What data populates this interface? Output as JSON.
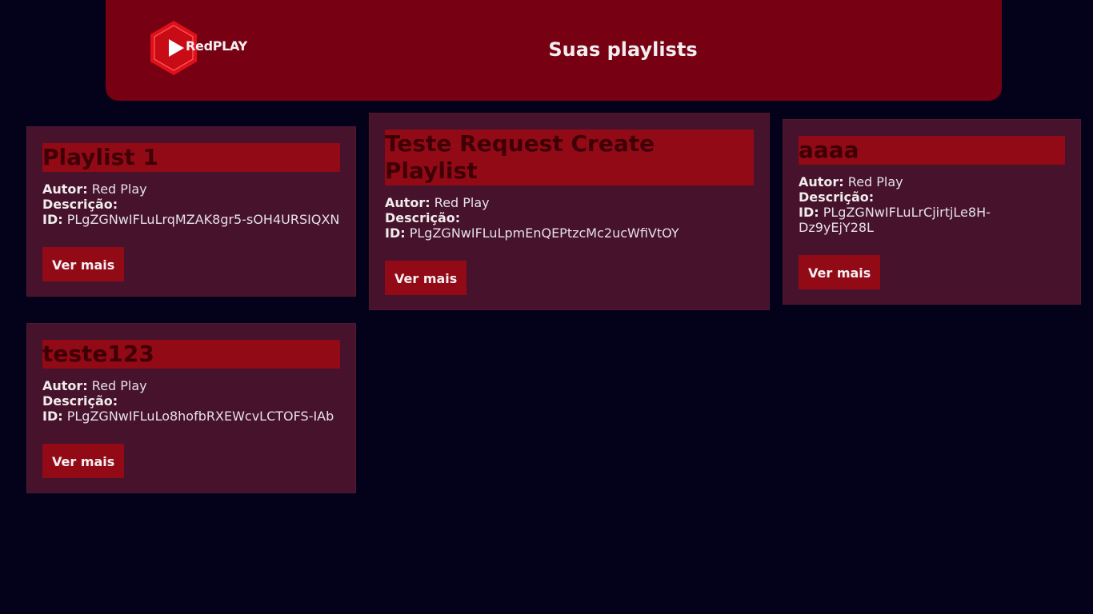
{
  "header": {
    "logo_text": "RedPLAY",
    "title": "Suas playlists"
  },
  "colors": {
    "background": "#03021a",
    "header": "#770012",
    "card": "#47122b",
    "accent": "#920a16"
  },
  "labels": {
    "author": "Autor:",
    "description": "Descrição:",
    "id": "ID:",
    "button": "Ver mais"
  },
  "playlists": [
    {
      "title": "Playlist 1",
      "author": "Red Play",
      "description": "",
      "id": "PLgZGNwIFLuLrqMZAK8gr5-sOH4URSIQXN"
    },
    {
      "title": "Teste Request Create Playlist",
      "author": "Red Play",
      "description": "",
      "id": "PLgZGNwIFLuLpmEnQEPtzcMc2ucWfiVtOY"
    },
    {
      "title": "aaaa",
      "author": "Red Play",
      "description": "",
      "id": "PLgZGNwIFLuLrCjirtjLe8H-Dz9yEjY28L"
    },
    {
      "title": "teste123",
      "author": "Red Play",
      "description": "",
      "id": "PLgZGNwIFLuLo8hofbRXEWcvLCTOFS-IAb"
    }
  ]
}
